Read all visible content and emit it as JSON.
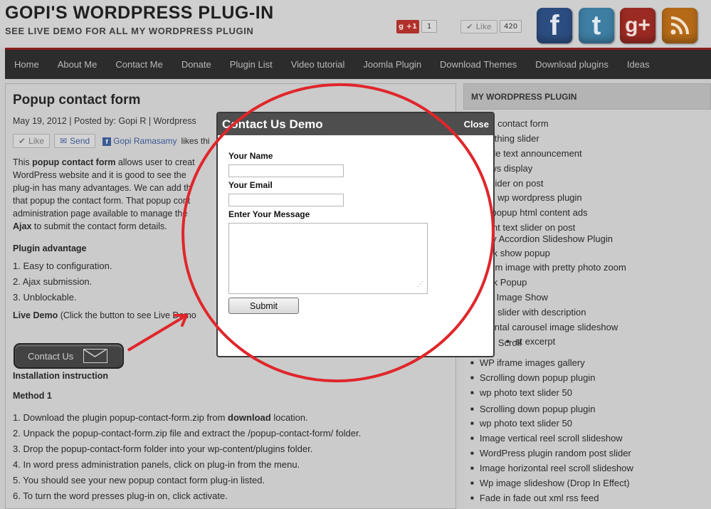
{
  "header": {
    "site_title": "GOPI'S WORDPRESS PLUG-IN",
    "site_subtitle": "SEE LIVE DEMO FOR ALL MY WORDPRESS PLUGIN",
    "gplus_label": "+1",
    "gplus_count": "1",
    "like_label": "Like",
    "like_count": "420"
  },
  "nav": {
    "items": [
      "Home",
      "About Me",
      "Contact Me",
      "Donate",
      "Plugin List",
      "Video tutorial",
      "Joomla Plugin",
      "Download Themes",
      "Download plugins",
      "Ideas"
    ]
  },
  "article": {
    "title": "Popup contact form",
    "meta": "May 19, 2012 | Posted by: Gopi R | Wordpress",
    "like_label": "Like",
    "send_label": "Send",
    "fb_name": "Gopi Ramasamy",
    "fb_likes": "likes thi",
    "intro_parts": {
      "p1": "This ",
      "bold1": "popup contact form",
      "p2": " allows user to creat",
      "line2": "WordPress website and it is good to see the",
      "line3": "plug-in has many advantages. We can add th",
      "line4": "that popup the contact form. That popup cont",
      "line5": "administration page available to manage the",
      "bold2": "Ajax",
      "p3": " to submit the contact form details."
    },
    "advantage_heading": "Plugin advantage",
    "advantages": [
      "1.  Easy to configuration.",
      "2.  Ajax submission.",
      "3.  Unblockable."
    ],
    "live_demo_bold": "Live Demo",
    "live_demo_rest": " (Click the button to see Live Demo",
    "contact_button": "Contact Us",
    "install_heading": "Installation instruction",
    "method_heading": "Method 1",
    "steps": [
      "1.  Download the plugin popup-contact-form.zip from ",
      "2.  Unpack the popup-contact-form.zip file and extract the /popup-contact-form/ folder.",
      "3.  Drop the popup-contact-form folder into your wp-content/plugins folder.",
      "4.  In word press administration panels, click on plug-in from the menu.",
      "5.  You should see your new popup contact form plug-in listed.",
      "6.  To turn the word presses plug-in on, click activate."
    ],
    "step1_bold": "download",
    "step1_tail": " location."
  },
  "sidebar": {
    "title": "MY WORDPRESS PLUGIN",
    "items": [
      "oup contact form",
      "anything slider",
      "cycle text announcement",
      "news display",
      "S slider on post",
      "one wp wordpress plugin",
      "oll popup html content ads",
      "ntent text slider on post",
      "llery Accordion Slideshow Plugin",
      "click show popup",
      "ndom image with pretty photo zoom",
      "click Popup",
      "acy Image Show",
      "age slider with description",
      "rizontal carousel image slideshow",
      "st excerpt",
      "Scroll",
      "WP iframe images gallery",
      "Scrolling down popup plugin",
      "wp photo text slider 50",
      "Scrolling down popup plugin",
      "wp photo text slider 50",
      "Image vertical reel scroll slideshow",
      "WordPress plugin random post slider",
      "Image horizontal reel scroll slideshow",
      "Wp image slideshow (Drop In Effect)",
      "Fade in fade out xml rss feed"
    ]
  },
  "popup": {
    "title": "Contact Us Demo",
    "close_label": "Close",
    "name_label": "Your Name",
    "email_label": "Your Email",
    "message_label": "Enter Your Message",
    "name_value": "",
    "email_value": "",
    "message_value": "",
    "submit_label": "Submit"
  },
  "colors": {
    "annotation_red": "#e0262b",
    "nav_bg": "#2c2c2c",
    "popup_header": "#4e4e4e"
  }
}
